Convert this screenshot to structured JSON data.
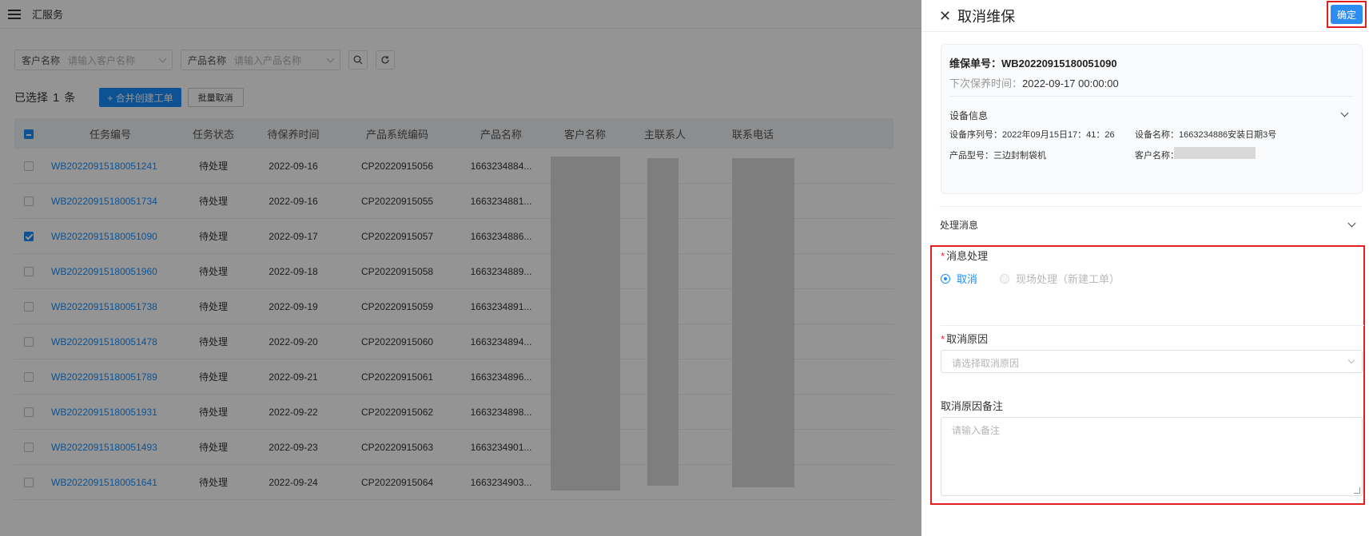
{
  "app": {
    "title": "汇服务"
  },
  "filters": {
    "customer": {
      "label": "客户名称",
      "placeholder": "请输入客户名称"
    },
    "product": {
      "label": "产品名称",
      "placeholder": "请输入产品名称"
    }
  },
  "selection": {
    "prefix": "已选择",
    "count": "1",
    "suffix": "条"
  },
  "toolbar": {
    "merge_label": "+ 合并创建工单",
    "batch_cancel_label": "批量取消"
  },
  "table": {
    "headers": [
      "任务编号",
      "任务状态",
      "待保养时间",
      "产品系统编码",
      "产品名称",
      "客户名称",
      "主联系人",
      "联系电话"
    ],
    "rows": [
      {
        "no": "WB20220915180051241",
        "status": "待处理",
        "date": "2022-09-16",
        "code": "CP20220915056",
        "product": "1663234884...",
        "checked": false
      },
      {
        "no": "WB20220915180051734",
        "status": "待处理",
        "date": "2022-09-16",
        "code": "CP20220915055",
        "product": "1663234881...",
        "checked": false
      },
      {
        "no": "WB20220915180051090",
        "status": "待处理",
        "date": "2022-09-17",
        "code": "CP20220915057",
        "product": "1663234886...",
        "checked": true
      },
      {
        "no": "WB20220915180051960",
        "status": "待处理",
        "date": "2022-09-18",
        "code": "CP20220915058",
        "product": "1663234889...",
        "checked": false
      },
      {
        "no": "WB20220915180051738",
        "status": "待处理",
        "date": "2022-09-19",
        "code": "CP20220915059",
        "product": "1663234891...",
        "checked": false
      },
      {
        "no": "WB20220915180051478",
        "status": "待处理",
        "date": "2022-09-20",
        "code": "CP20220915060",
        "product": "1663234894...",
        "checked": false
      },
      {
        "no": "WB20220915180051789",
        "status": "待处理",
        "date": "2022-09-21",
        "code": "CP20220915061",
        "product": "1663234896...",
        "checked": false
      },
      {
        "no": "WB20220915180051931",
        "status": "待处理",
        "date": "2022-09-22",
        "code": "CP20220915062",
        "product": "1663234898...",
        "checked": false
      },
      {
        "no": "WB20220915180051493",
        "status": "待处理",
        "date": "2022-09-23",
        "code": "CP20220915063",
        "product": "1663234901...",
        "checked": false
      },
      {
        "no": "WB20220915180051641",
        "status": "待处理",
        "date": "2022-09-24",
        "code": "CP20220915064",
        "product": "1663234903...",
        "checked": false
      }
    ]
  },
  "drawer": {
    "title": "取消维保",
    "confirm_label": "确定",
    "order_no": "维保单号：WB20220915180051090",
    "next_time_label": "下次保养时间：",
    "next_time_value": "2022-09-17 00:00:00",
    "device_section": "设备信息",
    "device_serial": "设备序列号：2022年09月15日17：41：26",
    "device_name": "设备名称：1663234886安装日期3号",
    "product_model": "产品型号：三边封制袋机",
    "customer_name_label": "客户名称：",
    "process_section": "处理消息",
    "handling_label": "消息处理",
    "radio_cancel": "取消",
    "radio_onsite": "现场处理（新建工单）",
    "reason_label": "取消原因",
    "reason_placeholder": "请选择取消原因",
    "remark_label": "取消原因备注",
    "remark_placeholder": "请输入备注"
  },
  "colors": {
    "accent": "#1890ff",
    "highlight_border": "#e02020",
    "confirm_button": "#2d8cf0"
  }
}
